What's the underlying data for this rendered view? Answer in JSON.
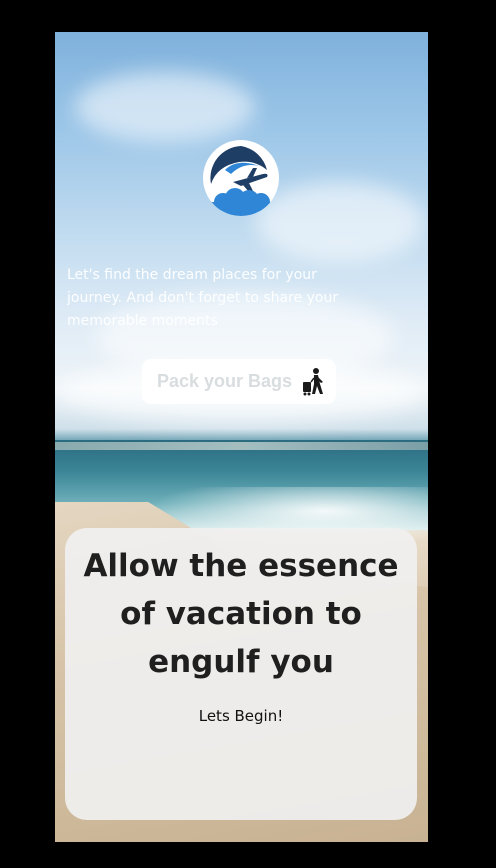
{
  "hero": {
    "tagline": "Let's find the dream places for your journey. And don't forget to share your memorable moments"
  },
  "pack_button": {
    "label": "Pack your Bags",
    "icon": "traveler-with-luggage-icon"
  },
  "card": {
    "title": "Allow the essence of vacation to engulf you",
    "begin_label": "Lets Begin!"
  },
  "logo": {
    "icon": "airplane-logo-icon",
    "colors": {
      "navy": "#1f3e66",
      "blue": "#2f86d6",
      "white": "#ffffff"
    }
  }
}
